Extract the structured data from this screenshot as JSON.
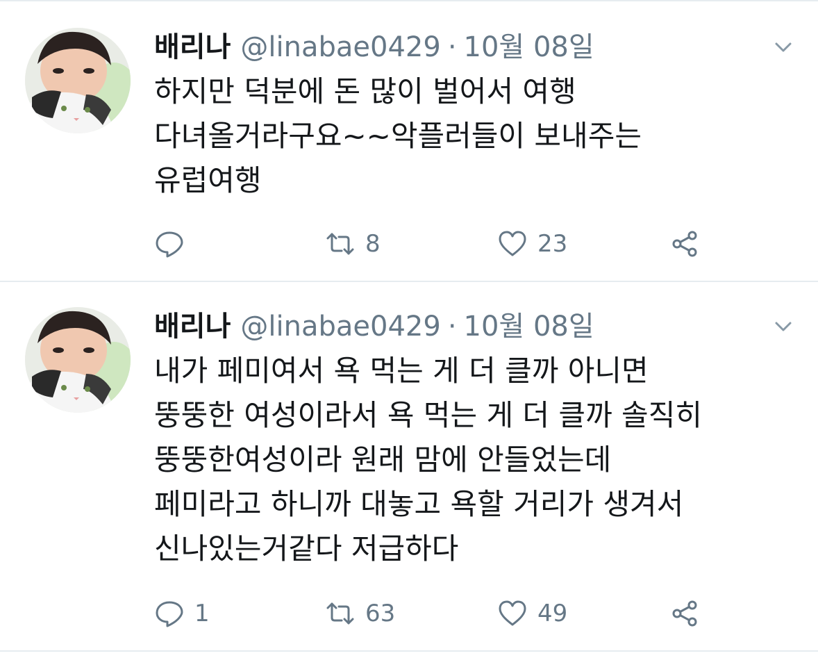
{
  "colors": {
    "text_primary": "#14171a",
    "text_secondary": "#657786",
    "divider": "#e6ecf0",
    "icon": "#657786"
  },
  "tweets": [
    {
      "display_name": "배리나",
      "handle": "@linabae0429",
      "separator": "·",
      "date": "10월 08일",
      "text_lines": [
        "하지만 덕분에 돈 많이 벌어서 여행",
        "다녀올거라구요~~악플러들이 보내주는",
        "유럽여행"
      ],
      "reply_count": "",
      "retweet_count": "8",
      "like_count": "23",
      "icons": [
        "reply-icon",
        "retweet-icon",
        "like-icon",
        "share-icon",
        "chevron-down-icon"
      ]
    },
    {
      "display_name": "배리나",
      "handle": "@linabae0429",
      "separator": "·",
      "date": "10월 08일",
      "text_lines": [
        "내가 페미여서 욕 먹는 게 더 클까 아니면",
        "뚱뚱한 여성이라서 욕 먹는 게 더 클까 솔직히",
        "뚱뚱한여성이라 원래 맘에 안들었는데",
        "페미라고 하니까 대놓고 욕할 거리가 생겨서",
        "신나있는거같다 저급하다"
      ],
      "reply_count": "1",
      "retweet_count": "63",
      "like_count": "49",
      "icons": [
        "reply-icon",
        "retweet-icon",
        "like-icon",
        "share-icon",
        "chevron-down-icon"
      ]
    }
  ]
}
